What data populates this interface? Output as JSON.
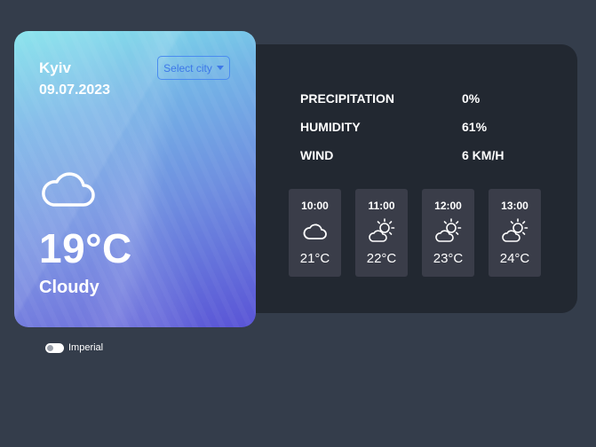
{
  "location": {
    "city": "Kyiv",
    "date": "09.07.2023",
    "select_label": "Select city"
  },
  "current": {
    "temperature": "19°C",
    "condition": "Cloudy",
    "icon": "cloud-icon"
  },
  "stats": [
    {
      "label": "PRECIPITATION",
      "value": "0%"
    },
    {
      "label": "HUMIDITY",
      "value": "61%"
    },
    {
      "label": "WIND",
      "value": "6 KM/H"
    }
  ],
  "hourly": [
    {
      "time": "10:00",
      "temp": "21°C",
      "icon": "cloud-icon"
    },
    {
      "time": "11:00",
      "temp": "22°C",
      "icon": "partly-sunny-icon"
    },
    {
      "time": "12:00",
      "temp": "23°C",
      "icon": "partly-sunny-icon"
    },
    {
      "time": "13:00",
      "temp": "24°C",
      "icon": "partly-sunny-icon"
    }
  ],
  "units": {
    "label": "Imperial",
    "enabled": false
  },
  "colors": {
    "page_bg": "#343d4b",
    "panel_bg": "#222831",
    "hour_card_bg": "#3a3d49",
    "accent": "#3d78e8"
  }
}
